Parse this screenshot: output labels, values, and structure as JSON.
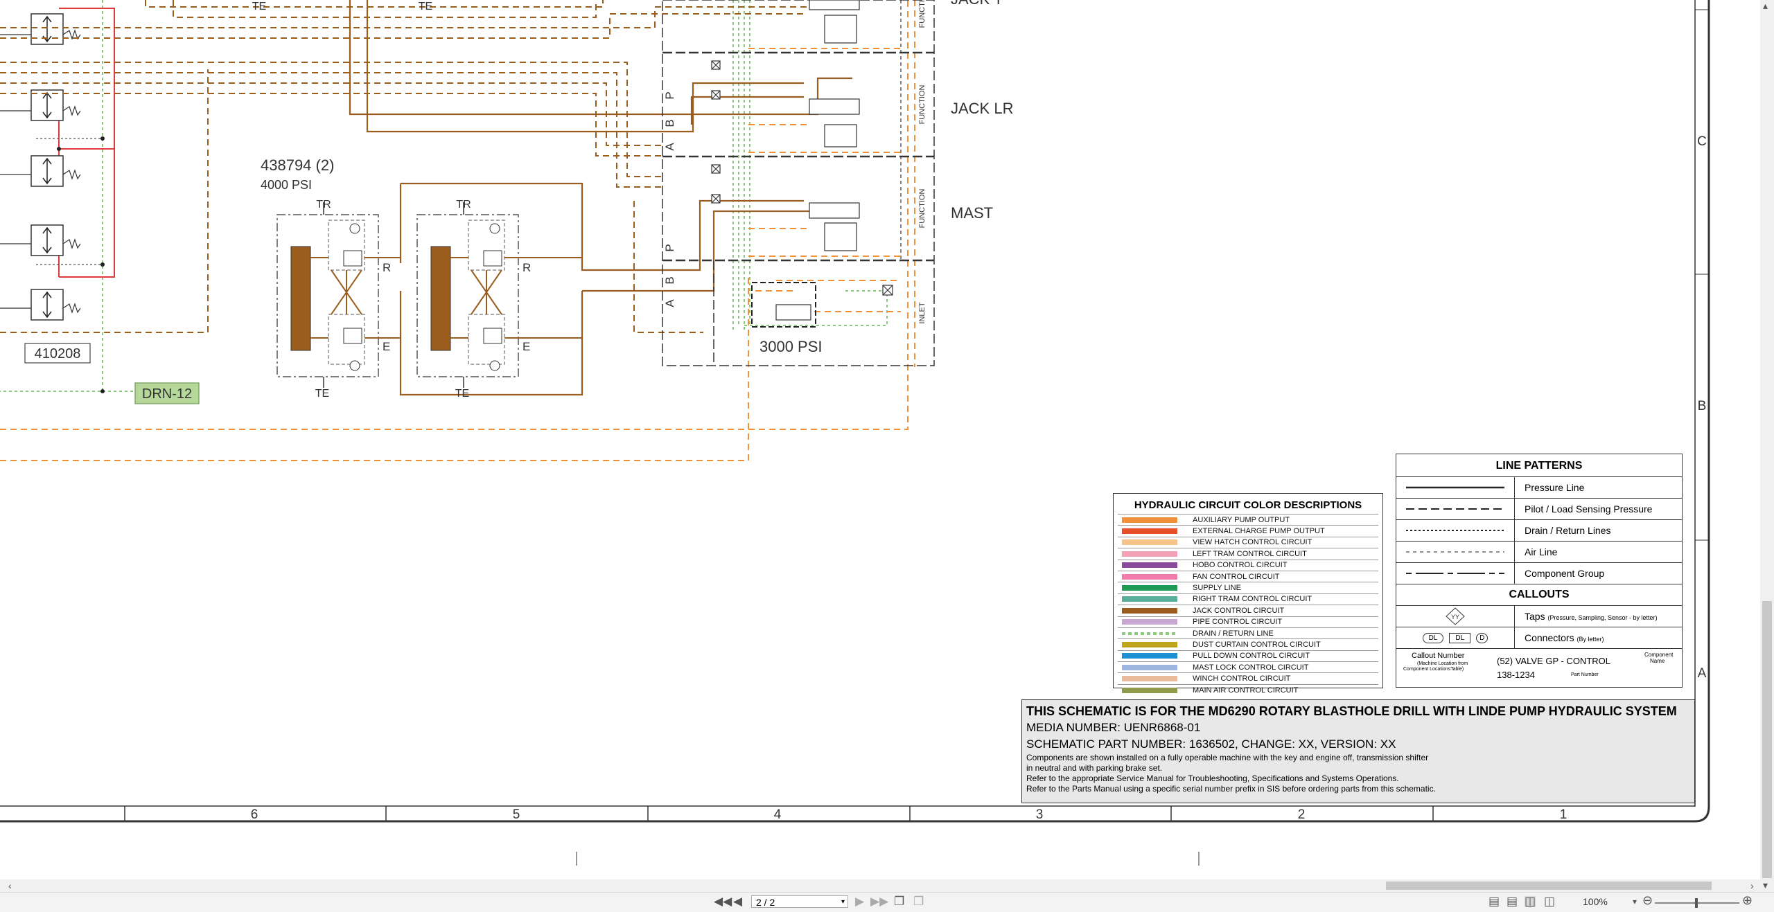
{
  "schematic": {
    "valve_callout": "438794 (2)",
    "valve_pressure": "4000 PSI",
    "component_410208": "410208",
    "drn_tag": "DRN-12",
    "bank_pressure": "3000 PSI",
    "function_labels": {
      "jack_top": "JACK T",
      "jack_lr": "JACK LR",
      "mast": "MAST"
    },
    "port_labels": {
      "te": "TE",
      "tr": "TR",
      "r": "R",
      "e": "E",
      "p": "P",
      "b": "B",
      "a": "A"
    },
    "vertical_labels": {
      "function": "FUNCTION",
      "inlet": "INLET"
    },
    "zone_numbers": [
      "6",
      "5",
      "4",
      "3",
      "2",
      "1"
    ],
    "zone_letters": [
      "C",
      "B",
      "A"
    ]
  },
  "color_legend": {
    "title": "HYDRAULIC CIRCUIT COLOR DESCRIPTIONS",
    "items": [
      {
        "label": "AUXILIARY PUMP OUTPUT",
        "color": "#f0913a"
      },
      {
        "label": "EXTERNAL CHARGE PUMP OUTPUT",
        "color": "#e5502a"
      },
      {
        "label": "VIEW HATCH CONTROL CIRCUIT",
        "color": "#f6c48a"
      },
      {
        "label": "LEFT TRAM CONTROL CIRCUIT",
        "color": "#f2a0b6"
      },
      {
        "label": "HOBO CONTROL CIRCUIT",
        "color": "#8a4b9c"
      },
      {
        "label": "FAN CONTROL CIRCUIT",
        "color": "#f07cae"
      },
      {
        "label": "SUPPLY LINE",
        "color": "#1e9a55"
      },
      {
        "label": "RIGHT TRAM CONTROL CIRCUIT",
        "color": "#5aae9c"
      },
      {
        "label": "JACK CONTROL CIRCUIT",
        "color": "#9b5d1e"
      },
      {
        "label": "PIPE CONTROL CIRCUIT",
        "color": "#c9a8d4"
      },
      {
        "label": "DRAIN / RETURN LINE",
        "color": "#8bc87a"
      },
      {
        "label": "DUST CURTAIN CONTROL CIRCUIT",
        "color": "#bfa417"
      },
      {
        "label": "PULL DOWN CONTROL CIRCUIT",
        "color": "#1b8fd0"
      },
      {
        "label": "MAST LOCK CONTROL CIRCUIT",
        "color": "#9db6df"
      },
      {
        "label": "WINCH CONTROL CIRCUIT",
        "color": "#e9bb9a"
      },
      {
        "label": "MAIN AIR CONTROL CIRCUIT",
        "color": "#8f9a4a"
      }
    ]
  },
  "line_legend": {
    "title": "LINE PATTERNS",
    "patterns": [
      {
        "label": "Pressure Line",
        "style": "solid"
      },
      {
        "label": "Pilot / Load Sensing Pressure",
        "style": "dashed"
      },
      {
        "label": "Drain / Return Lines",
        "style": "dotted"
      },
      {
        "label": "Air Line",
        "style": "fine-dashed"
      },
      {
        "label": "Component Group",
        "style": "dash-dot"
      }
    ],
    "callouts_title": "CALLOUTS",
    "taps_label": "Taps",
    "taps_note": "(Pressure, Sampling, Sensor - by letter)",
    "taps_symbol": "YY",
    "connectors_label": "Connectors",
    "connectors_note": "(By letter)",
    "connector_symbols": [
      "DL",
      "DL",
      "D"
    ],
    "example_callout_label": "Callout Number",
    "example_callout_note1": "(Machine Location from",
    "example_callout_note2": "Component LocationsTable)",
    "example_value": "(52) VALVE GP - CONTROL",
    "example_component_label1": "Component",
    "example_component_label2": "Name",
    "example_part_number": "138-1234",
    "example_part_label": "Part Number"
  },
  "title_block": {
    "line1": "THIS SCHEMATIC IS FOR THE MD6290 ROTARY BLASTHOLE DRILL WITH LINDE PUMP HYDRAULIC SYSTEM",
    "line2": "MEDIA NUMBER: UENR6868-01",
    "line3": "SCHEMATIC PART NUMBER: 1636502, CHANGE: XX, VERSION: XX",
    "note1": "Components are shown installed on a fully operable machine with the key and engine off, transmission shifter",
    "note2": "in neutral and with parking brake set.",
    "note3": "Refer to the appropriate Service Manual for Troubleshooting, Specifications and Systems Operations.",
    "note4": "Refer to the Parts Manual using a specific serial number prefix in SIS before ordering parts from this schematic."
  },
  "viewer": {
    "page_indicator": "2 / 2",
    "zoom_level": "100%"
  }
}
